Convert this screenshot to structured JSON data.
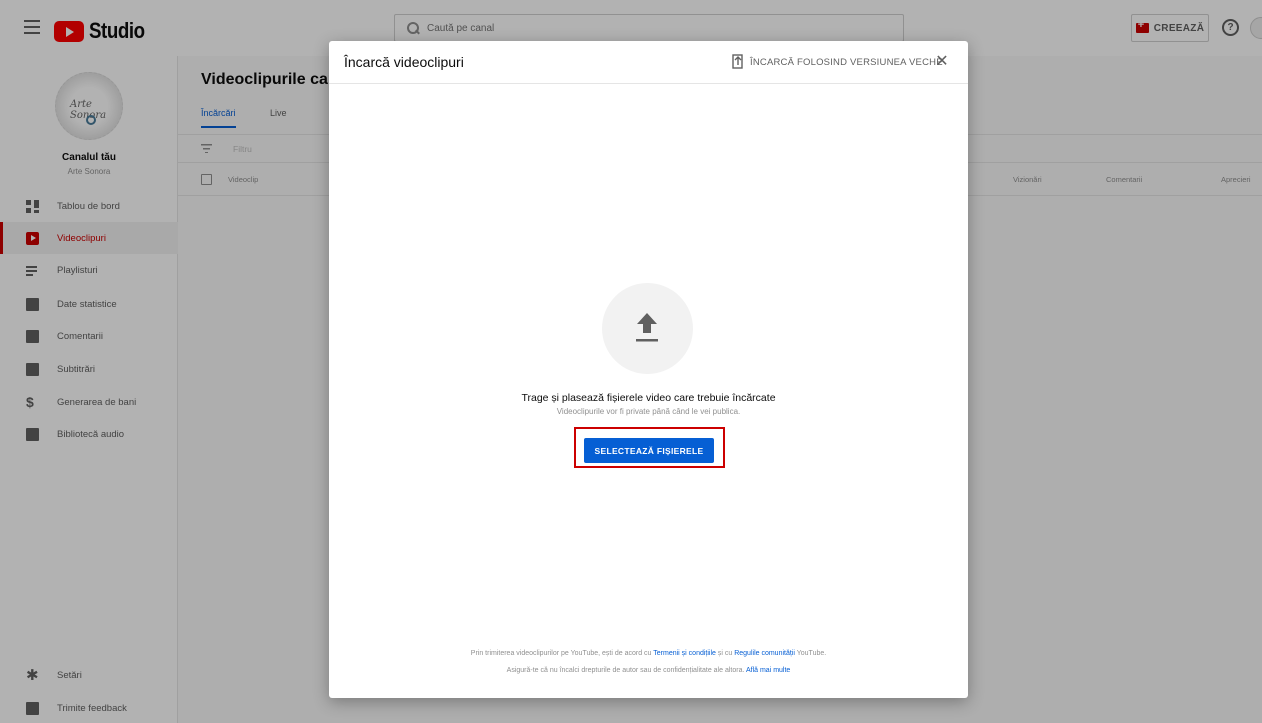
{
  "topbar": {
    "logo_text": "Studio",
    "search_placeholder": "Caută pe canal",
    "create_label": "CREEAZĂ",
    "help_glyph": "?"
  },
  "sidebar": {
    "channel_title": "Canalul tău",
    "channel_name": "Arte Sonora",
    "avatar_text": "Arte Sonora",
    "items": [
      {
        "label": "Tablou de bord",
        "icon": "dashboard-icon"
      },
      {
        "label": "Videoclipuri",
        "icon": "video-icon",
        "active": true
      },
      {
        "label": "Playlisturi",
        "icon": "playlist-icon"
      },
      {
        "label": "Date statistice",
        "icon": "stats-icon"
      },
      {
        "label": "Comentarii",
        "icon": "comments-icon"
      },
      {
        "label": "Subtitrări",
        "icon": "subtitles-icon"
      },
      {
        "label": "Generarea de bani",
        "icon": "money-icon"
      },
      {
        "label": "Bibliotecă audio",
        "icon": "audio-library-icon"
      }
    ],
    "bottom_items": [
      {
        "label": "Setări",
        "icon": "gear-icon"
      },
      {
        "label": "Trimite feedback",
        "icon": "feedback-icon"
      }
    ]
  },
  "main": {
    "title": "Videoclipurile canalului",
    "tabs": [
      {
        "label": "Încărcări",
        "active": true
      },
      {
        "label": "Live"
      }
    ],
    "filter_label": "Filtru",
    "columns": {
      "video": "Videoclip",
      "views": "Vizionări",
      "comments": "Comentarii",
      "likes": "Aprecieri"
    }
  },
  "dialog": {
    "title": "Încarcă videoclipuri",
    "legacy_label": "ÎNCARCĂ FOLOSIND VERSIUNEA VECHE",
    "close_glyph": "✕",
    "drag_text": "Trage și plasează fișierele video care trebuie încărcate",
    "private_text": "Videoclipurile vor fi private până când le vei publica.",
    "select_button": "SELECTEAZĂ FIȘIERELE",
    "terms_prefix": "Prin trimiterea videoclipurilor pe YouTube, ești de acord cu ",
    "terms_link": "Termenii și condițiile",
    "terms_mid": " și cu ",
    "community_link": "Regulile comunității",
    "terms_suffix": " YouTube.",
    "rights_prefix": "Asigură-te că nu încalci drepturile de autor sau de confidențialitate ale altora. ",
    "learn_more_link": "Află mai multe"
  },
  "colors": {
    "accent": "#065fd4",
    "brand_red": "#cc0000",
    "highlight": "#cc0000"
  }
}
